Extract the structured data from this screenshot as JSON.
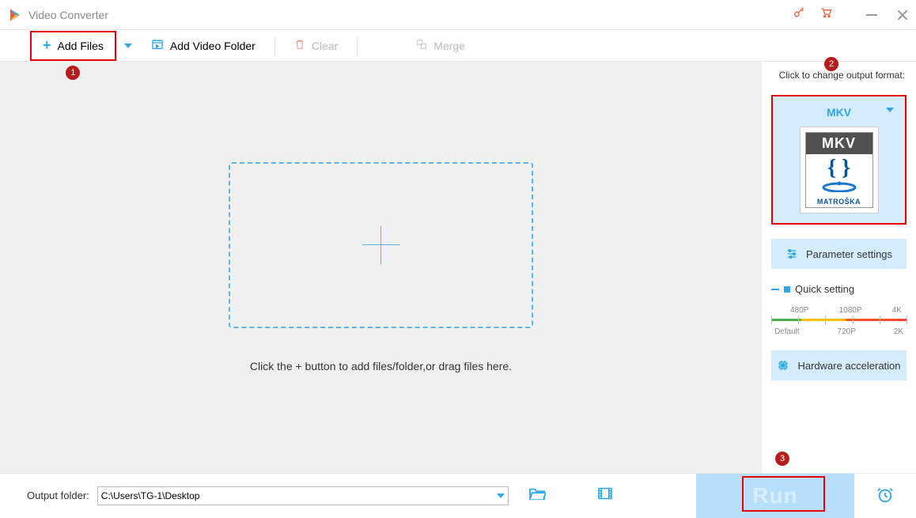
{
  "title": "Video Converter",
  "toolbar": {
    "add_files": "Add Files",
    "add_folder": "Add Video Folder",
    "clear": "Clear",
    "merge": "Merge"
  },
  "badges": {
    "one": "1",
    "two": "2",
    "three": "3"
  },
  "dropzone": {
    "hint": "Click the + button to add files/folder,or drag files here."
  },
  "sidebar": {
    "format_label": "Click to change output format:",
    "format_name": "MKV",
    "logo_top": "MKV",
    "logo_braces": "{ }",
    "logo_text": "MATROŠKA",
    "param_settings": "Parameter settings",
    "quick_setting": "Quick setting",
    "labels_top": [
      "480P",
      "1080P",
      "4K"
    ],
    "labels_bot": [
      "Default",
      "720P",
      "2K"
    ],
    "hw_accel": "Hardware acceleration"
  },
  "bottom": {
    "output_label": "Output folder:",
    "output_path": "C:\\Users\\TG-1\\Desktop",
    "run": "Run"
  }
}
